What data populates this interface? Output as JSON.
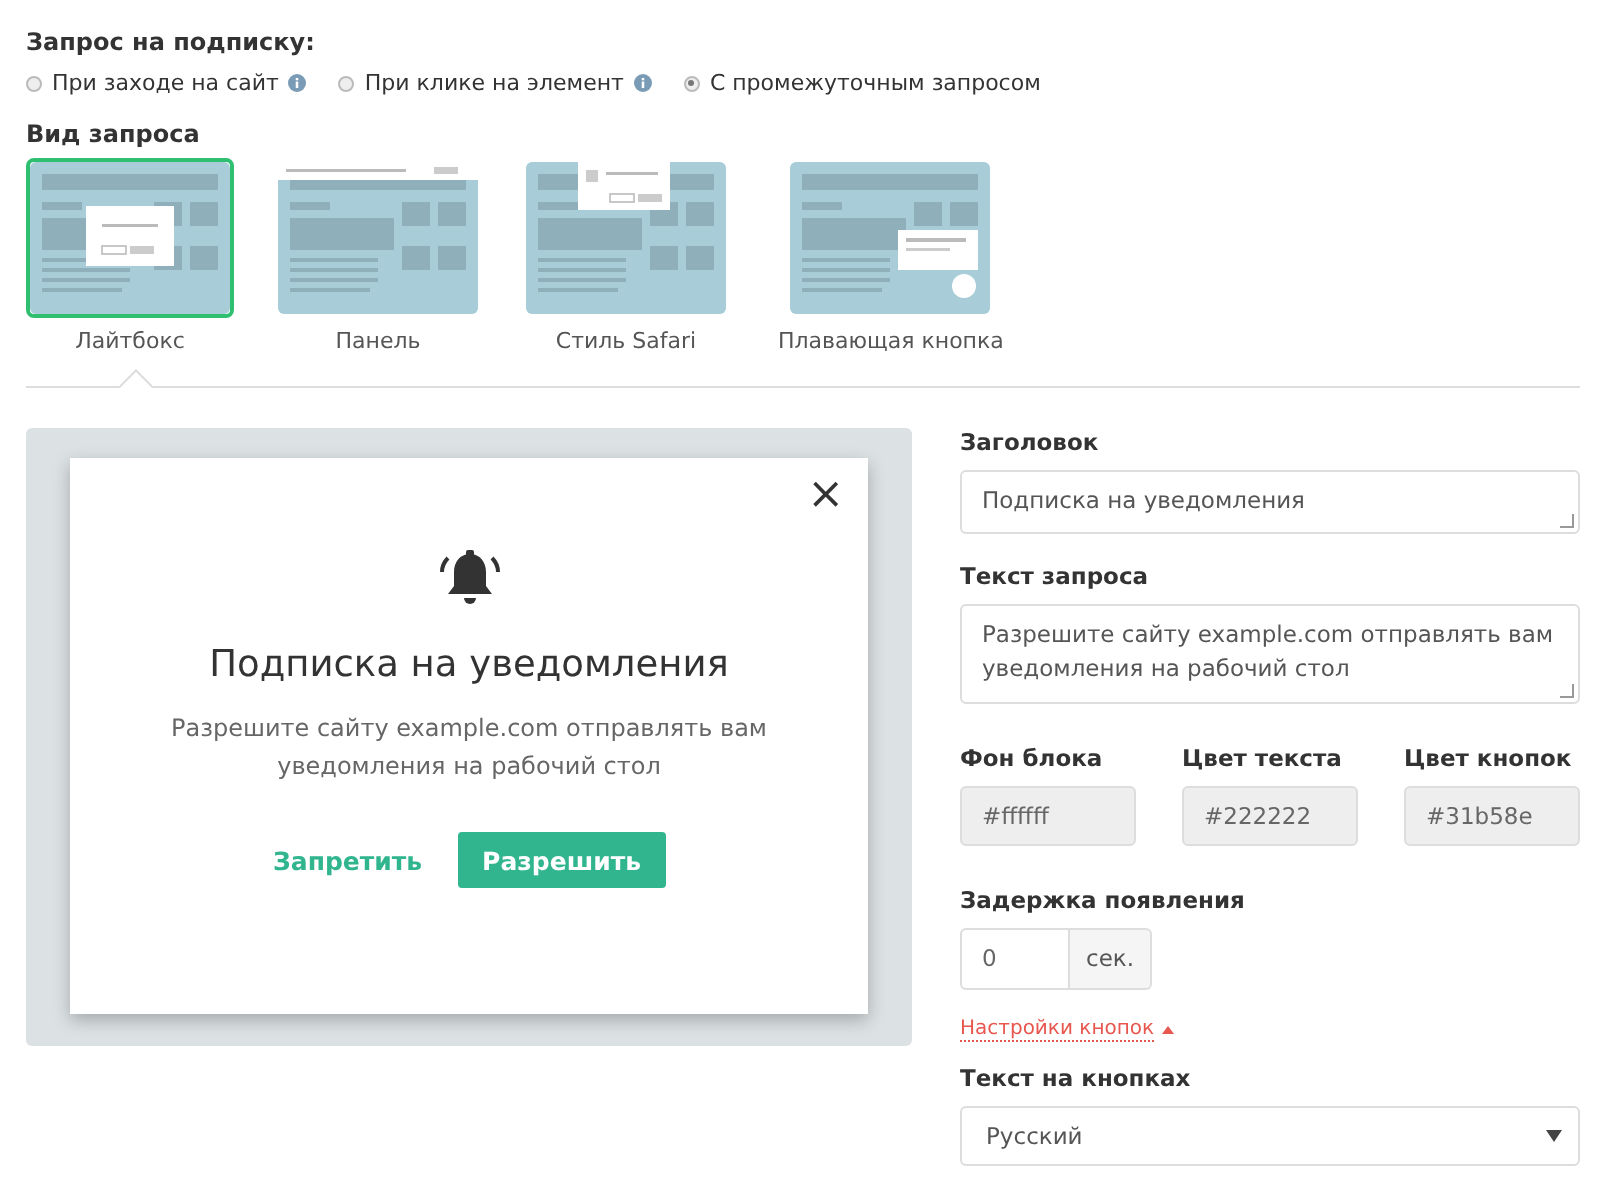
{
  "trigger": {
    "title": "Запрос на подписку:",
    "options": [
      {
        "label": "При заходе на сайт",
        "selected": false,
        "info": true
      },
      {
        "label": "При клике на элемент",
        "selected": false,
        "info": true
      },
      {
        "label": "С промежуточным запросом",
        "selected": true,
        "info": false
      }
    ]
  },
  "view": {
    "title": "Вид запроса",
    "tabs": [
      {
        "label": "Лайтбокс",
        "kind": "lightbox",
        "selected": true
      },
      {
        "label": "Панель",
        "kind": "panel",
        "selected": false
      },
      {
        "label": "Стиль Safari",
        "kind": "safari",
        "selected": false
      },
      {
        "label": "Плавающая кнопка",
        "kind": "floating",
        "selected": false
      }
    ]
  },
  "preview": {
    "close": "×",
    "title": "Подписка на уведомления",
    "text": "Разрешите сайту example.com отправлять вам уведомления на рабочий стол",
    "deny": "Запретить",
    "allow": "Разрешить"
  },
  "form": {
    "title_label": "Заголовок",
    "title_value": "Подписка на уведомления",
    "text_label": "Текст запроса",
    "text_value": "Разрешите сайту example.com отправлять вам уведомления на рабочий стол",
    "colors": [
      {
        "label": "Фон блока",
        "value": "#ffffff"
      },
      {
        "label": "Цвет текста",
        "value": "#222222"
      },
      {
        "label": "Цвет кнопок",
        "value": "#31b58e"
      }
    ],
    "delay_label": "Задержка появления",
    "delay_value": "0",
    "delay_unit": "сек.",
    "buttons_link": "Настройки кнопок",
    "buttons_text_label": "Текст на кнопках",
    "language": "Русский"
  }
}
